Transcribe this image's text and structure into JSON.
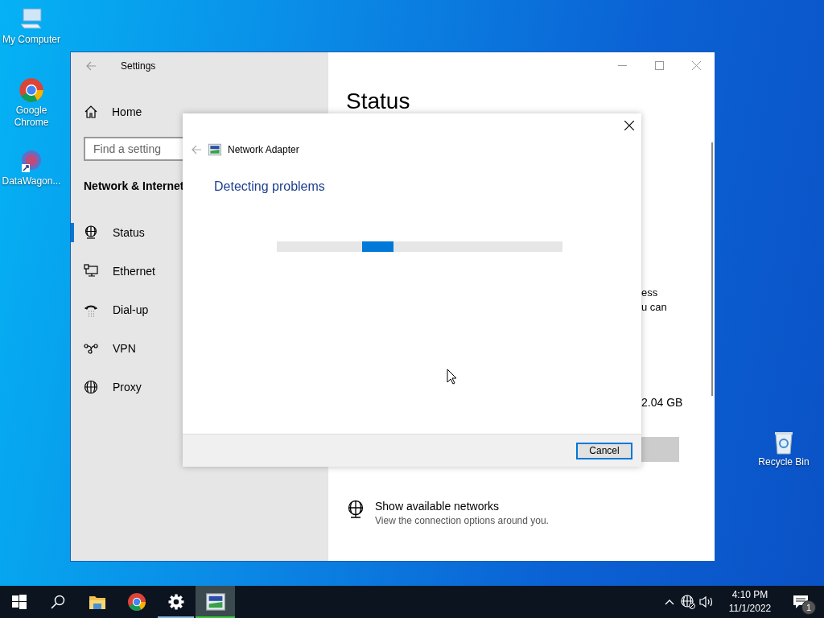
{
  "desktop_icons": [
    {
      "label": "My Computer",
      "kind": "computer"
    },
    {
      "label": "Google Chrome",
      "kind": "chrome"
    },
    {
      "label": "DataWagon...",
      "kind": "datawagon"
    }
  ],
  "recycle_bin": {
    "label": "Recycle Bin"
  },
  "settings_window": {
    "title": "Settings",
    "home": "Home",
    "search": {
      "placeholder": "Find a setting"
    },
    "section": "Network & Internet",
    "nav": [
      {
        "label": "Status",
        "kind": "status",
        "selected": true
      },
      {
        "label": "Ethernet",
        "kind": "ethernet",
        "selected": false
      },
      {
        "label": "Dial-up",
        "kind": "dialup",
        "selected": false
      },
      {
        "label": "VPN",
        "kind": "vpn",
        "selected": false
      },
      {
        "label": "Proxy",
        "kind": "proxy",
        "selected": false
      }
    ],
    "page_title": "Status",
    "text_fragments": [
      "ess",
      "u can"
    ],
    "usage": "2.04 GB",
    "networks_link": {
      "title": "Show available networks",
      "description": "View the connection options around you."
    }
  },
  "troubleshooter": {
    "title": "Network Adapter",
    "heading": "Detecting problems",
    "buttons": [
      "Cancel"
    ]
  },
  "taskbar": {
    "apps": [
      {
        "kind": "folder",
        "running": false,
        "active": false
      },
      {
        "kind": "chrome",
        "running": false,
        "active": false
      },
      {
        "kind": "settings",
        "running": true,
        "active": false
      },
      {
        "kind": "adapter",
        "running": true,
        "active": true
      }
    ],
    "time": "4:10 PM",
    "date": "11/1/2022",
    "notification_count": "1"
  }
}
